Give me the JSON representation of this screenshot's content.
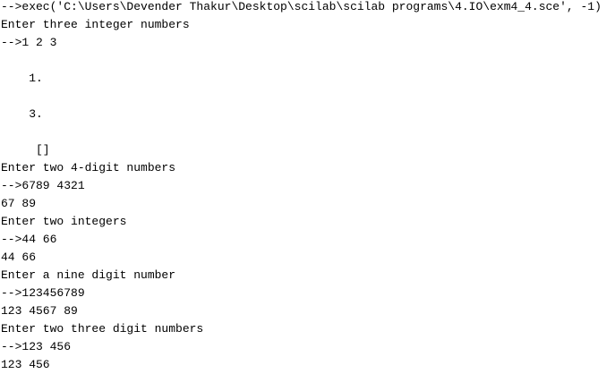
{
  "console": {
    "lines": [
      "-->exec('C:\\Users\\Devender Thakur\\Desktop\\scilab\\scilab programs\\4.IO\\exm4_4.sce', -1)",
      "Enter three integer numbers",
      "-->1 2 3",
      "    1.",
      "    3.",
      "     []",
      "Enter two 4-digit numbers",
      "-->6789 4321",
      "67 89",
      "Enter two integers",
      "-->44 66",
      "44 66",
      "Enter a nine digit number",
      "-->123456789",
      "123 4567 89",
      "Enter two three digit numbers",
      "-->123 456",
      "123 456"
    ]
  }
}
